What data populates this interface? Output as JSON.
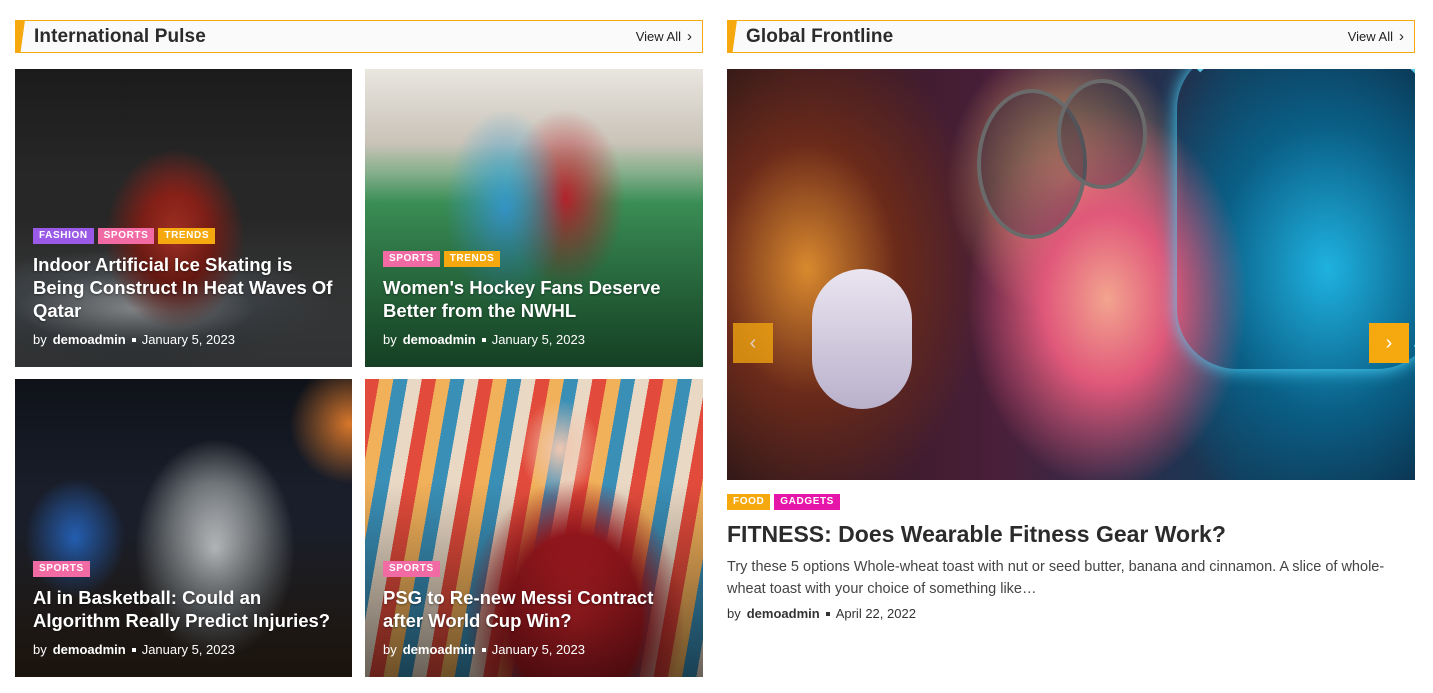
{
  "left_section": {
    "title": "International Pulse",
    "view_all": "View All"
  },
  "right_section": {
    "title": "Global Frontline",
    "view_all": "View All"
  },
  "cards": [
    {
      "tags": [
        "FASHION",
        "SPORTS",
        "TRENDS"
      ],
      "title": "Indoor Artificial Ice Skating is Being Construct In Heat Waves Of Qatar",
      "by": "by",
      "author": "demoadmin",
      "date": "January 5, 2023"
    },
    {
      "tags": [
        "SPORTS",
        "TRENDS"
      ],
      "title": "Women's Hockey Fans Deserve Better from the NWHL",
      "by": "by",
      "author": "demoadmin",
      "date": "January 5, 2023"
    },
    {
      "tags": [
        "SPORTS"
      ],
      "title": "AI in Basketball: Could an Algorithm Really Predict Injuries?",
      "by": "by",
      "author": "demoadmin",
      "date": "January 5, 2023"
    },
    {
      "tags": [
        "SPORTS"
      ],
      "title": "PSG to Re-new Messi Contract after World Cup Win?",
      "by": "by",
      "author": "demoadmin",
      "date": "January 5, 2023"
    }
  ],
  "slider": {
    "prev_icon": "chevron-left-icon",
    "next_icon": "chevron-right-icon"
  },
  "feature": {
    "tags": [
      "FOOD",
      "GADGETS"
    ],
    "title": "FITNESS: Does Wearable Fitness Gear Work?",
    "excerpt": "Try these 5 options Whole-wheat toast with nut or seed butter, banana and cinnamon. A slice of whole-wheat toast with your choice of something like…",
    "by": "by",
    "author": "demoadmin",
    "date": "April 22, 2022"
  },
  "colors": {
    "accent": "#f5a90f",
    "tag_purple": "#9b59e8",
    "tag_pink": "#f26aa3",
    "tag_orange": "#f5a90f",
    "tag_magenta": "#e617a8"
  }
}
